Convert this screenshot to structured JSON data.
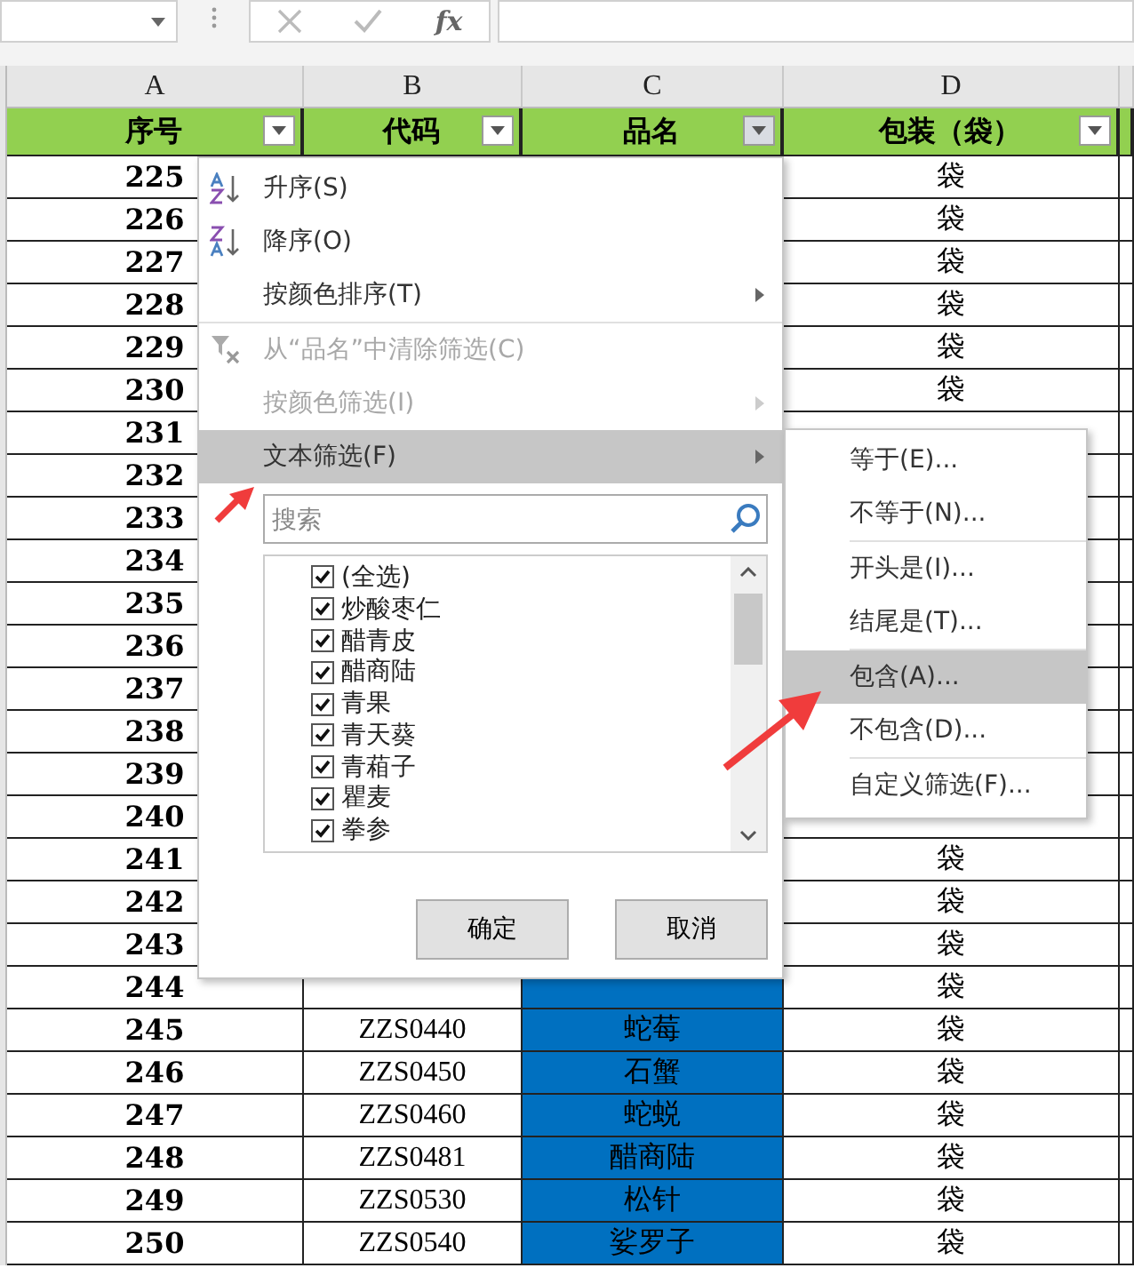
{
  "formula_bar": {
    "fx": "fx"
  },
  "columns": [
    {
      "letter": "A",
      "header": "序号",
      "filter_active": false
    },
    {
      "letter": "B",
      "header": "代码",
      "filter_active": false
    },
    {
      "letter": "C",
      "header": "品名",
      "filter_active": true
    },
    {
      "letter": "D",
      "header": "包装（袋）",
      "filter_active": false
    }
  ],
  "rows": [
    {
      "no": "225",
      "unit": "袋"
    },
    {
      "no": "226",
      "unit": "袋"
    },
    {
      "no": "227",
      "unit": "袋"
    },
    {
      "no": "228",
      "unit": "袋"
    },
    {
      "no": "229",
      "unit": "袋"
    },
    {
      "no": "230",
      "unit": "袋"
    },
    {
      "no": "231"
    },
    {
      "no": "232"
    },
    {
      "no": "233"
    },
    {
      "no": "234"
    },
    {
      "no": "235"
    },
    {
      "no": "236"
    },
    {
      "no": "237"
    },
    {
      "no": "238"
    },
    {
      "no": "239"
    },
    {
      "no": "240"
    },
    {
      "no": "241",
      "unit": "袋"
    },
    {
      "no": "242",
      "unit": "袋"
    },
    {
      "no": "243",
      "unit": "袋"
    },
    {
      "no": "244",
      "unit": "袋",
      "selected": true
    },
    {
      "no": "245",
      "code": "ZZS0440",
      "name": "蛇莓",
      "unit": "袋",
      "selected": true
    },
    {
      "no": "246",
      "code": "ZZS0450",
      "name": "石蟹",
      "unit": "袋",
      "selected": true
    },
    {
      "no": "247",
      "code": "ZZS0460",
      "name": "蛇蜕",
      "unit": "袋",
      "selected": true
    },
    {
      "no": "248",
      "code": "ZZS0481",
      "name": "醋商陆",
      "unit": "袋",
      "selected": true
    },
    {
      "no": "249",
      "code": "ZZS0530",
      "name": "松针",
      "unit": "袋",
      "selected": true
    },
    {
      "no": "250",
      "code": "ZZS0540",
      "name": "娑罗子",
      "unit": "袋",
      "selected": true
    }
  ],
  "filter_menu": {
    "items": [
      {
        "label": "升序(S)",
        "kind": "sort-asc",
        "disabled": false,
        "submenu": false,
        "highlighted": false
      },
      {
        "label": "降序(O)",
        "kind": "sort-desc",
        "disabled": false,
        "submenu": false,
        "highlighted": false
      },
      {
        "label": "按颜色排序(T)",
        "kind": "plain",
        "disabled": false,
        "submenu": true,
        "highlighted": false
      },
      {
        "label": "从“品名”中清除筛选(C)",
        "kind": "clear-filter",
        "disabled": true,
        "submenu": false,
        "highlighted": false
      },
      {
        "label": "按颜色筛选(I)",
        "kind": "plain",
        "disabled": true,
        "submenu": true,
        "highlighted": false
      },
      {
        "label": "文本筛选(F)",
        "kind": "plain",
        "disabled": false,
        "submenu": true,
        "highlighted": true
      }
    ],
    "search": {
      "placeholder": "搜索"
    },
    "values": [
      {
        "label": "(全选)",
        "checked": true
      },
      {
        "label": "炒酸枣仁",
        "checked": true
      },
      {
        "label": "醋青皮",
        "checked": true
      },
      {
        "label": "醋商陆",
        "checked": true
      },
      {
        "label": "青果",
        "checked": true
      },
      {
        "label": "青天葵",
        "checked": true
      },
      {
        "label": "青葙子",
        "checked": true
      },
      {
        "label": "瞿麦",
        "checked": true
      },
      {
        "label": "拳参",
        "checked": true
      }
    ],
    "buttons": [
      "确定",
      "取消"
    ]
  },
  "text_filter_menu": {
    "items": [
      {
        "label": "等于(E)...",
        "highlighted": false,
        "separator_after": false
      },
      {
        "label": "不等于(N)...",
        "highlighted": false,
        "separator_after": true
      },
      {
        "label": "开头是(I)...",
        "highlighted": false,
        "separator_after": false
      },
      {
        "label": "结尾是(T)...",
        "highlighted": false,
        "separator_after": true
      },
      {
        "label": "包含(A)...",
        "highlighted": true,
        "separator_after": false
      },
      {
        "label": "不包含(D)...",
        "highlighted": false,
        "separator_after": true
      },
      {
        "label": "自定义筛选(F)...",
        "highlighted": false,
        "separator_after": false
      }
    ]
  }
}
